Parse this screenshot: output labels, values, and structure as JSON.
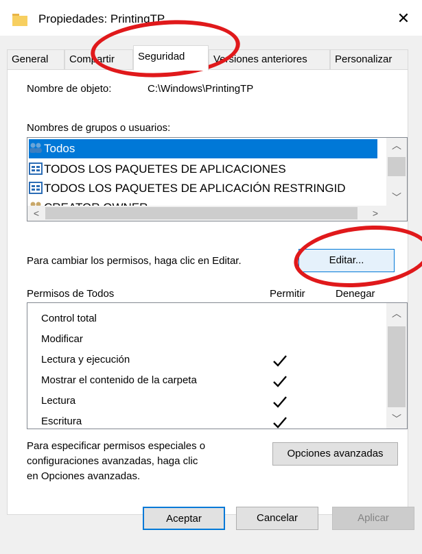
{
  "window": {
    "title": "Propiedades: PrintingTP",
    "close_glyph": "✕"
  },
  "tabs": [
    {
      "label": "General",
      "active": false
    },
    {
      "label": "Compartir",
      "active": false
    },
    {
      "label": "Seguridad",
      "active": true
    },
    {
      "label": "Versiones anteriores",
      "active": false
    },
    {
      "label": "Personalizar",
      "active": false
    }
  ],
  "security": {
    "object_name_label": "Nombre de objeto:",
    "object_name_value": "C:\\Windows\\PrintingTP",
    "groups_label": "Nombres de grupos o usuarios:",
    "groups": [
      {
        "name": "Todos",
        "icon": "users-icon",
        "selected": true
      },
      {
        "name": "TODOS LOS PAQUETES DE APLICACIONES",
        "icon": "app-package-icon",
        "selected": false
      },
      {
        "name": "TODOS LOS PAQUETES DE APLICACIÓN RESTRINGID",
        "icon": "app-package-icon",
        "selected": false
      },
      {
        "name": "CREATOR OWNER",
        "icon": "users-icon",
        "selected": false
      }
    ],
    "change_perms_text": "Para cambiar los permisos, haga clic en Editar.",
    "edit_button": "Editar...",
    "perms_for_label": "Permisos de Todos",
    "col_allow": "Permitir",
    "col_deny": "Denegar",
    "permissions": [
      {
        "name": "Control total",
        "allow": false,
        "deny": false
      },
      {
        "name": "Modificar",
        "allow": false,
        "deny": false
      },
      {
        "name": "Lectura y ejecución",
        "allow": true,
        "deny": false
      },
      {
        "name": "Mostrar el contenido de la carpeta",
        "allow": true,
        "deny": false
      },
      {
        "name": "Lectura",
        "allow": true,
        "deny": false
      },
      {
        "name": "Escritura",
        "allow": true,
        "deny": false
      }
    ],
    "advanced_text_1": "Para especificar permisos especiales o",
    "advanced_text_2": "configuraciones avanzadas, haga clic",
    "advanced_text_3": "en Opciones avanzadas.",
    "advanced_button": "Opciones avanzadas"
  },
  "footer": {
    "ok": "Aceptar",
    "cancel": "Cancelar",
    "apply": "Aplicar"
  },
  "colors": {
    "selection": "#0078d7",
    "annotation": "#e0191b",
    "dialog_bg": "#f0f0f0"
  }
}
